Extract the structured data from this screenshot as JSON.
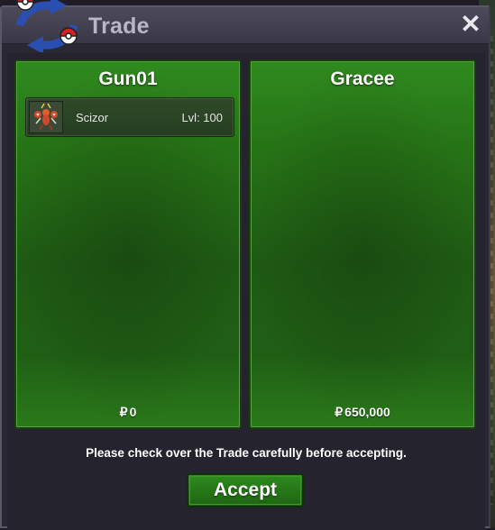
{
  "window": {
    "title": "Trade",
    "close_symbol": "✕"
  },
  "trade": {
    "left": {
      "trainer": "Gun01",
      "pokemon": [
        {
          "name": "Scizor",
          "level_text": "Lvl: 100",
          "icon": "scizor-sprite-icon"
        }
      ],
      "money_symbol": "₽",
      "money": "0"
    },
    "right": {
      "trainer": "Gracee",
      "pokemon": [],
      "money_symbol": "₽",
      "money": "650,000"
    }
  },
  "footer": {
    "notice": "Please check over the Trade carefully before accepting.",
    "accept_label": "Accept"
  },
  "colors": {
    "panel_green": "#267216",
    "button_green": "#2e8a1d",
    "title_text": "#b9b6c6"
  }
}
